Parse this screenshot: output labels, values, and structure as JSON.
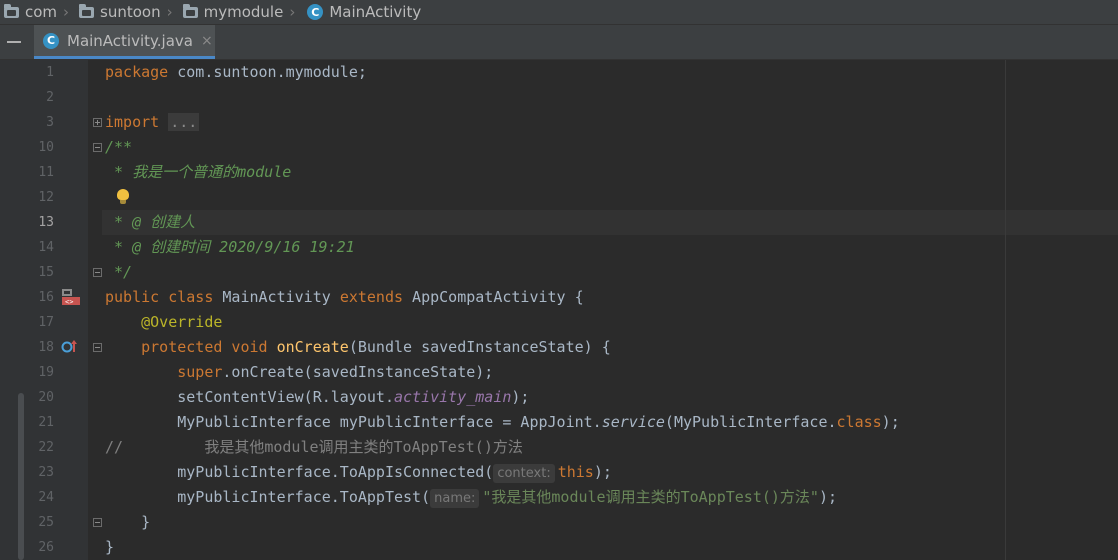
{
  "breadcrumb": {
    "items": [
      {
        "label": "com",
        "icon": "folder-icon"
      },
      {
        "label": "suntoon",
        "icon": "folder-icon"
      },
      {
        "label": "mymodule",
        "icon": "folder-icon"
      },
      {
        "label": "MainActivity",
        "icon": "class-icon"
      }
    ],
    "class_badge": "C"
  },
  "tab": {
    "label": "MainActivity.java",
    "close": "×",
    "badge": "C"
  },
  "lines": [
    {
      "n": "1"
    },
    {
      "n": "2"
    },
    {
      "n": "3"
    },
    {
      "n": "10"
    },
    {
      "n": "11"
    },
    {
      "n": "12"
    },
    {
      "n": "13"
    },
    {
      "n": "14"
    },
    {
      "n": "15"
    },
    {
      "n": "16"
    },
    {
      "n": "17"
    },
    {
      "n": "18"
    },
    {
      "n": "19"
    },
    {
      "n": "20"
    },
    {
      "n": "21"
    },
    {
      "n": "22"
    },
    {
      "n": "23"
    },
    {
      "n": "24"
    },
    {
      "n": "25"
    },
    {
      "n": "26"
    }
  ],
  "code": {
    "l1_kw": "package",
    "l1_rest": " com.suntoon.mymodule;",
    "l3_kw": "import",
    "l3_dots": "...",
    "l10": "/**",
    "l11": " * 我是一个普通的module",
    "l13": " * @ 创建人",
    "l14": " * @ 创建时间 2020/9/16 19:21",
    "l15": " */",
    "l16_kw1": "public class",
    "l16_name": " MainActivity ",
    "l16_kw2": "extends",
    "l16_rest": " AppCompatActivity {",
    "l17": "@Override",
    "l18_kw": "protected void",
    "l18_fn": "onCreate",
    "l18_rest": "(Bundle savedInstanceState) {",
    "l19_kw": "super",
    "l19_rest": ".onCreate(savedInstanceState);",
    "l20_a": "setContentView(R.layout.",
    "l20_field": "activity_main",
    "l20_b": ");",
    "l21_a": "MyPublicInterface myPublicInterface = AppJoint.",
    "l21_static": "service",
    "l21_b": "(MyPublicInterface.",
    "l21_kw": "class",
    "l21_c": ");",
    "l22_slash": "//",
    "l22_text": "我是其他module调用主类的ToAppTest()方法",
    "l23_a": "myPublicInterface.ToAppIsConnected(",
    "l23_hint": "context:",
    "l23_kw": "this",
    "l23_b": ");",
    "l24_a": "myPublicInterface.ToAppTest(",
    "l24_hint": "name:",
    "l24_str": "\"我是其他module调用主类的ToAppTest()方法\"",
    "l24_b": ");",
    "l25": "}",
    "l26": "}"
  },
  "colors": {
    "background": "#2b2b2b",
    "keyword": "#cc7832",
    "comment": "#629755",
    "annotation": "#bbb529",
    "method": "#ffc66d",
    "field": "#9876aa",
    "string": "#6a8759"
  }
}
